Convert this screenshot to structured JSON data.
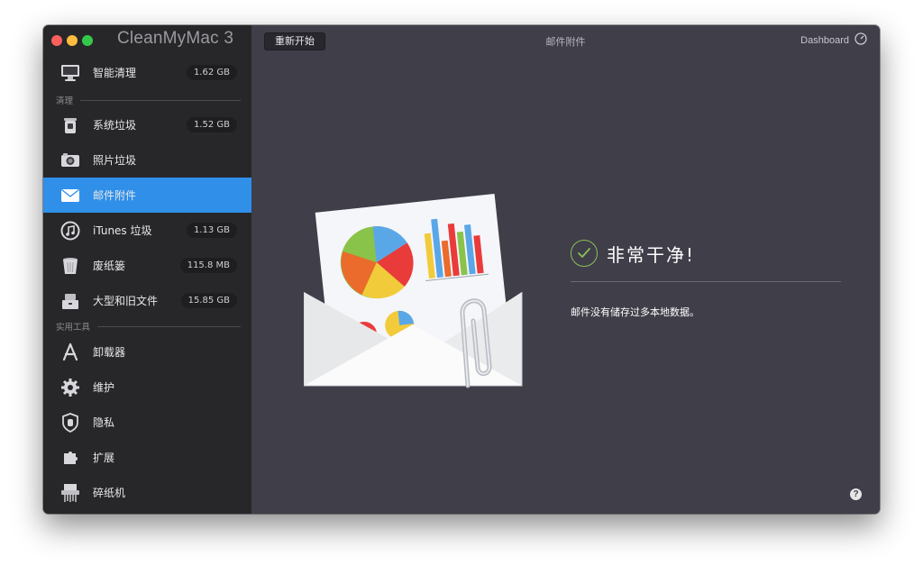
{
  "app": {
    "title": "CleanMyMac 3"
  },
  "toolbar": {
    "restart_label": "重新开始",
    "title": "邮件附件",
    "dashboard_label": "Dashboard"
  },
  "sidebar": {
    "top_item": {
      "label": "智能清理",
      "badge": "1.62 GB",
      "icon": "monitor-icon"
    },
    "section_clean": "清理",
    "clean_items": [
      {
        "label": "系统垃圾",
        "badge": "1.52 GB",
        "icon": "trash-bin-icon"
      },
      {
        "label": "照片垃圾",
        "badge": "",
        "icon": "camera-icon"
      },
      {
        "label": "邮件附件",
        "badge": "",
        "icon": "envelope-icon",
        "active": true
      },
      {
        "label": "iTunes 垃圾",
        "badge": "1.13 GB",
        "icon": "music-note-icon"
      },
      {
        "label": "废纸篓",
        "badge": "115.8 MB",
        "icon": "wastebasket-icon"
      },
      {
        "label": "大型和旧文件",
        "badge": "15.85 GB",
        "icon": "boxes-icon"
      }
    ],
    "section_tools": "实用工具",
    "tool_items": [
      {
        "label": "卸载器",
        "icon": "app-store-icon"
      },
      {
        "label": "维护",
        "icon": "gear-icon"
      },
      {
        "label": "隐私",
        "icon": "shield-hand-icon"
      },
      {
        "label": "扩展",
        "icon": "puzzle-icon"
      },
      {
        "label": "碎纸机",
        "icon": "shredder-icon"
      }
    ]
  },
  "main": {
    "status_heading": "非常干净!",
    "status_desc": "邮件没有储存过多本地数据。",
    "help_label": "?"
  },
  "colors": {
    "accent": "#2f8fe9",
    "success": "#8ac05a",
    "sidebar_bg": "#27272a",
    "main_bg": "#3f3e49"
  }
}
